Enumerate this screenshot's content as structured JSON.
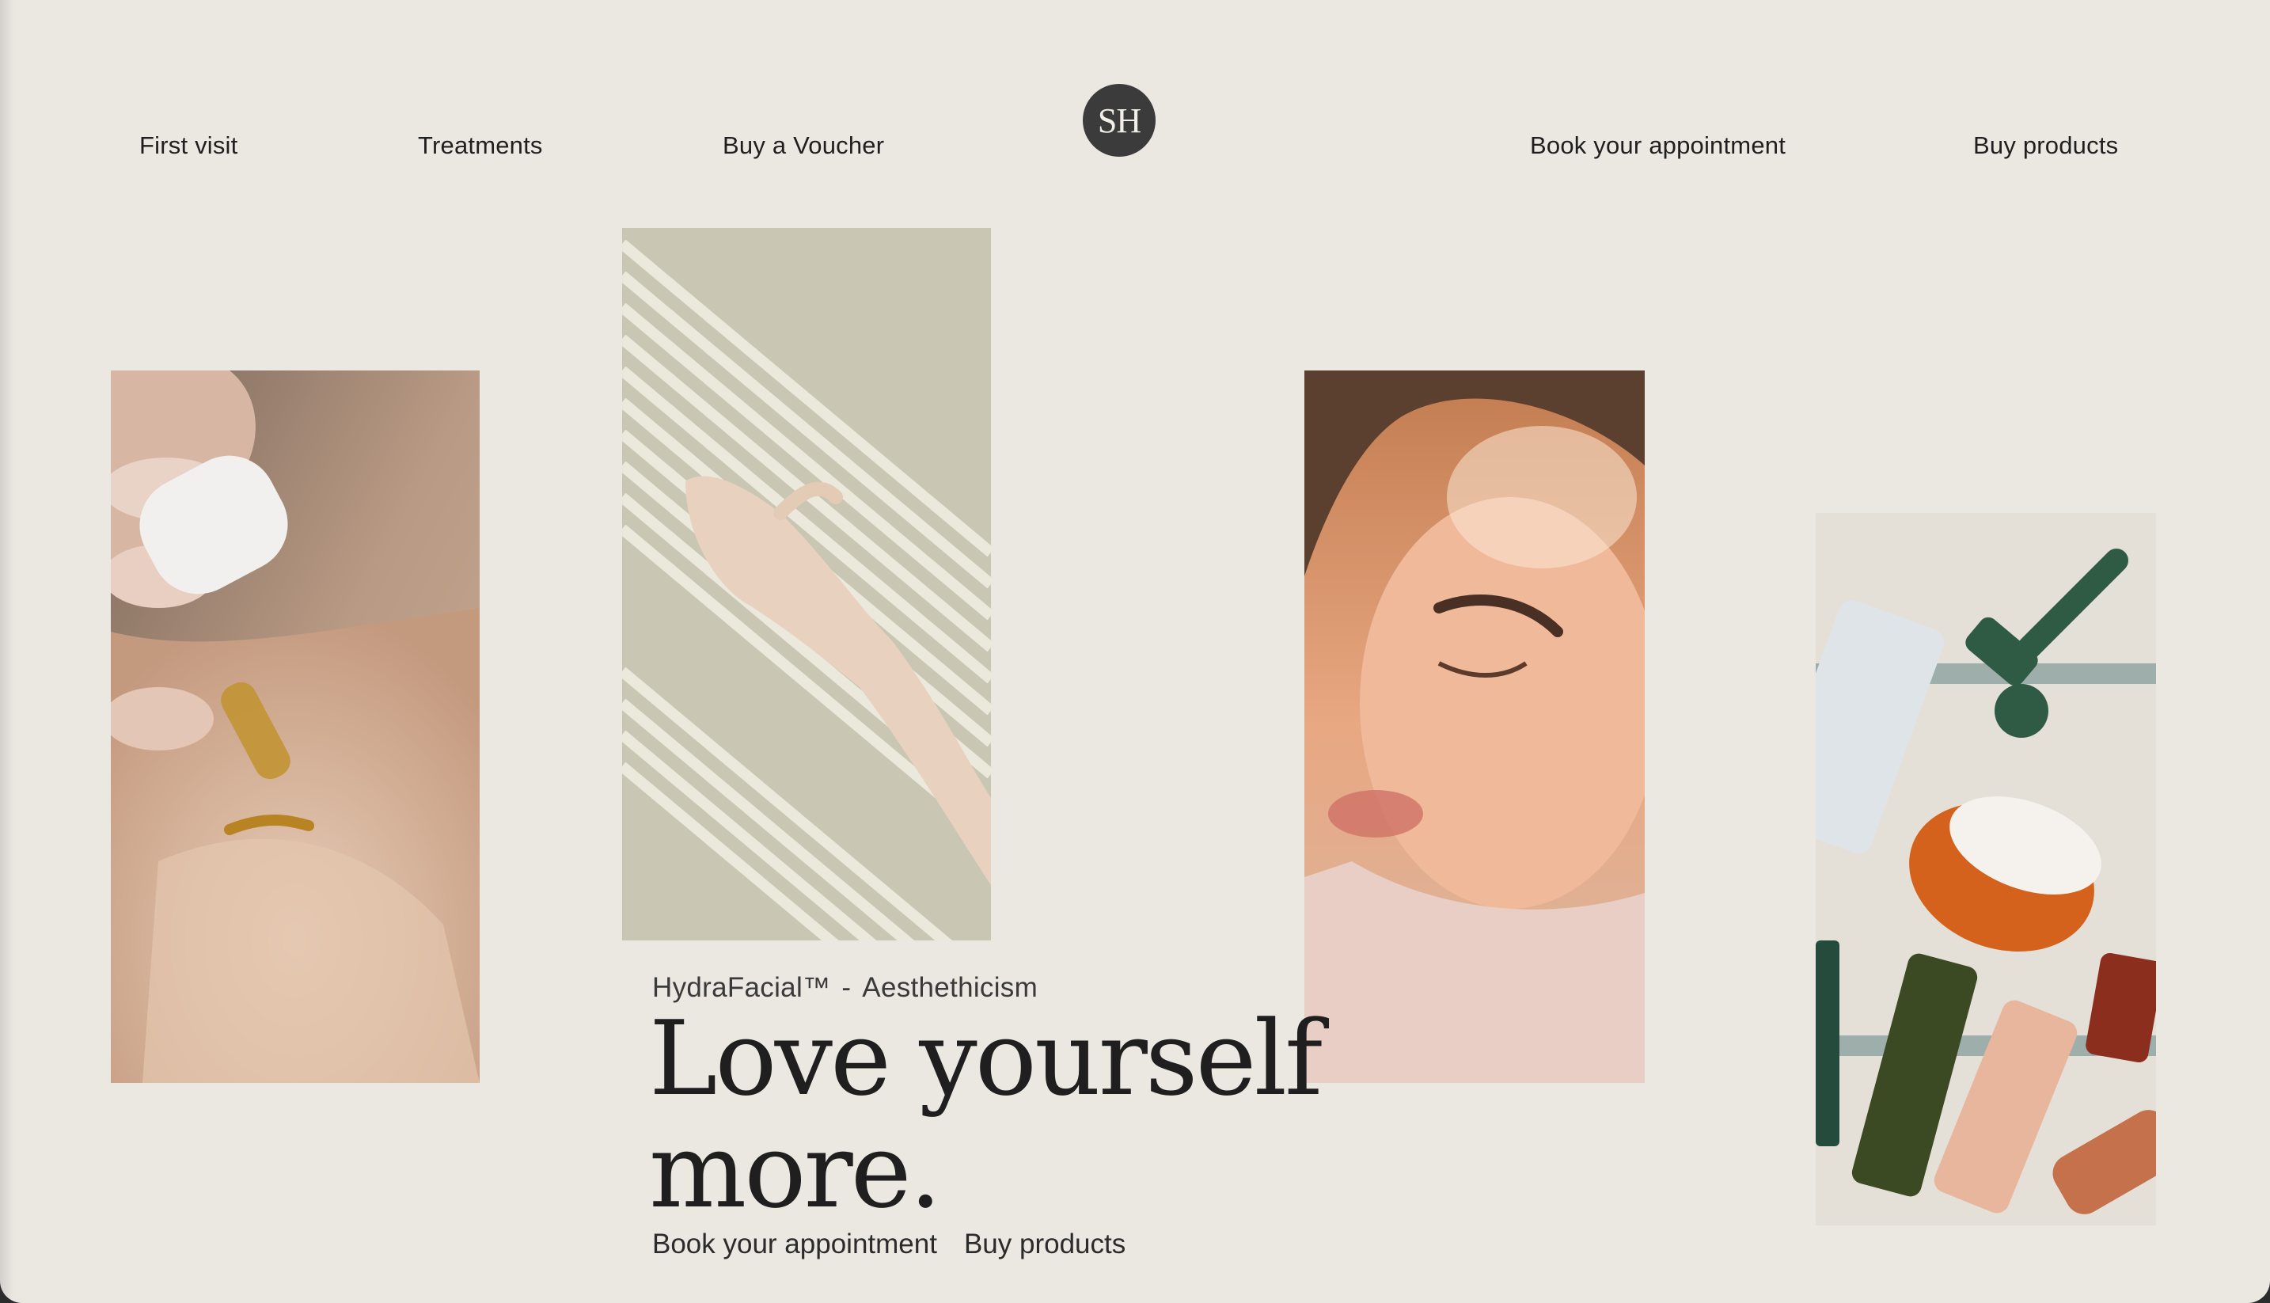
{
  "nav": {
    "left": [
      "First visit",
      "Treatments",
      "Buy a Voucher"
    ],
    "logo": "SH",
    "right": [
      "Book your appointment",
      "Buy products"
    ]
  },
  "hero": {
    "eyebrow_left": "HydraFacial™",
    "eyebrow_sep": "-",
    "eyebrow_right": "Aesthethicism",
    "headline_line1": "Love yourself",
    "headline_line2": "more.",
    "link_appointment": "Book your appointment",
    "link_products": "Buy products"
  },
  "images": [
    {
      "subject": "dropper-serum-on-hand-photo"
    },
    {
      "subject": "hand-in-striped-light-photo"
    },
    {
      "subject": "woman-face-sunlight-photo"
    },
    {
      "subject": "skincare-products-flatlay-photo"
    }
  ],
  "colors": {
    "background": "#ebe8e2",
    "text": "#1f1f1f",
    "logo_bg": "#3b3b3b"
  }
}
